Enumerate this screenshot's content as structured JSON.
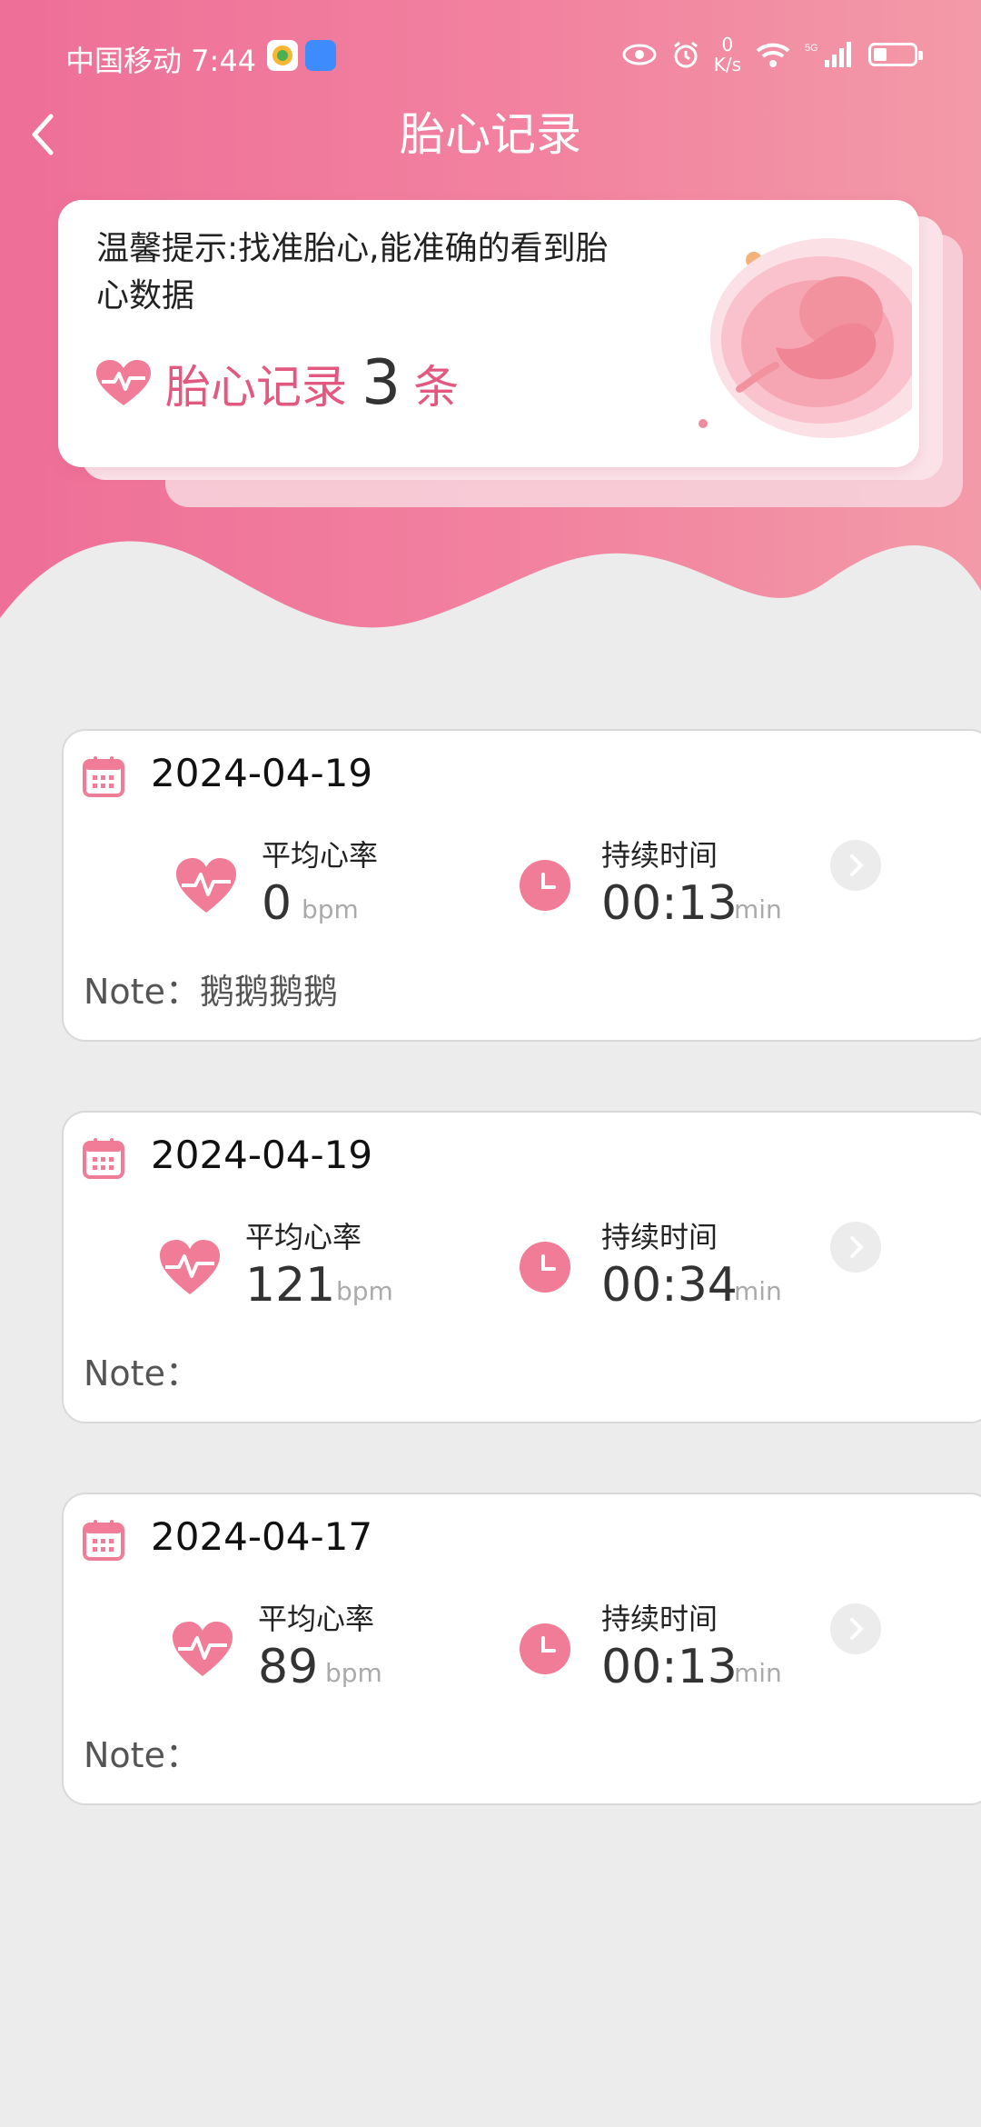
{
  "status": {
    "carrier_time": "中国移动 7:44",
    "net_speed_top": "0",
    "net_speed_bottom": "K/s"
  },
  "nav": {
    "title": "胎心记录"
  },
  "tip": {
    "text": "温馨提示:找准胎心,能准确的看到胎心数据",
    "count_label": "胎心记录",
    "count": "3",
    "count_unit": "条"
  },
  "records": [
    {
      "date": "2024-04-19",
      "hr_label": "平均心率",
      "hr_value": "0",
      "hr_unit": "bpm",
      "dur_label": "持续时间",
      "dur_value": "00:13",
      "dur_unit": "min",
      "note": "Note：鹅鹅鹅鹅"
    },
    {
      "date": "2024-04-19",
      "hr_label": "平均心率",
      "hr_value": "121",
      "hr_unit": "bpm",
      "dur_label": "持续时间",
      "dur_value": "00:34",
      "dur_unit": "min",
      "note": "Note："
    },
    {
      "date": "2024-04-17",
      "hr_label": "平均心率",
      "hr_value": "89",
      "hr_unit": "bpm",
      "dur_label": "持续时间",
      "dur_value": "00:13",
      "dur_unit": "min",
      "note": "Note："
    }
  ],
  "colors": {
    "accent": "#e2587f",
    "icon_pink": "#f07c97",
    "header_start": "#ee6f98",
    "header_end": "#f39aa8"
  },
  "icons": [
    "back-arrow-icon",
    "heartbeat-icon",
    "calendar-icon",
    "clock-icon",
    "chevron-right-icon",
    "fetus-illustration"
  ]
}
